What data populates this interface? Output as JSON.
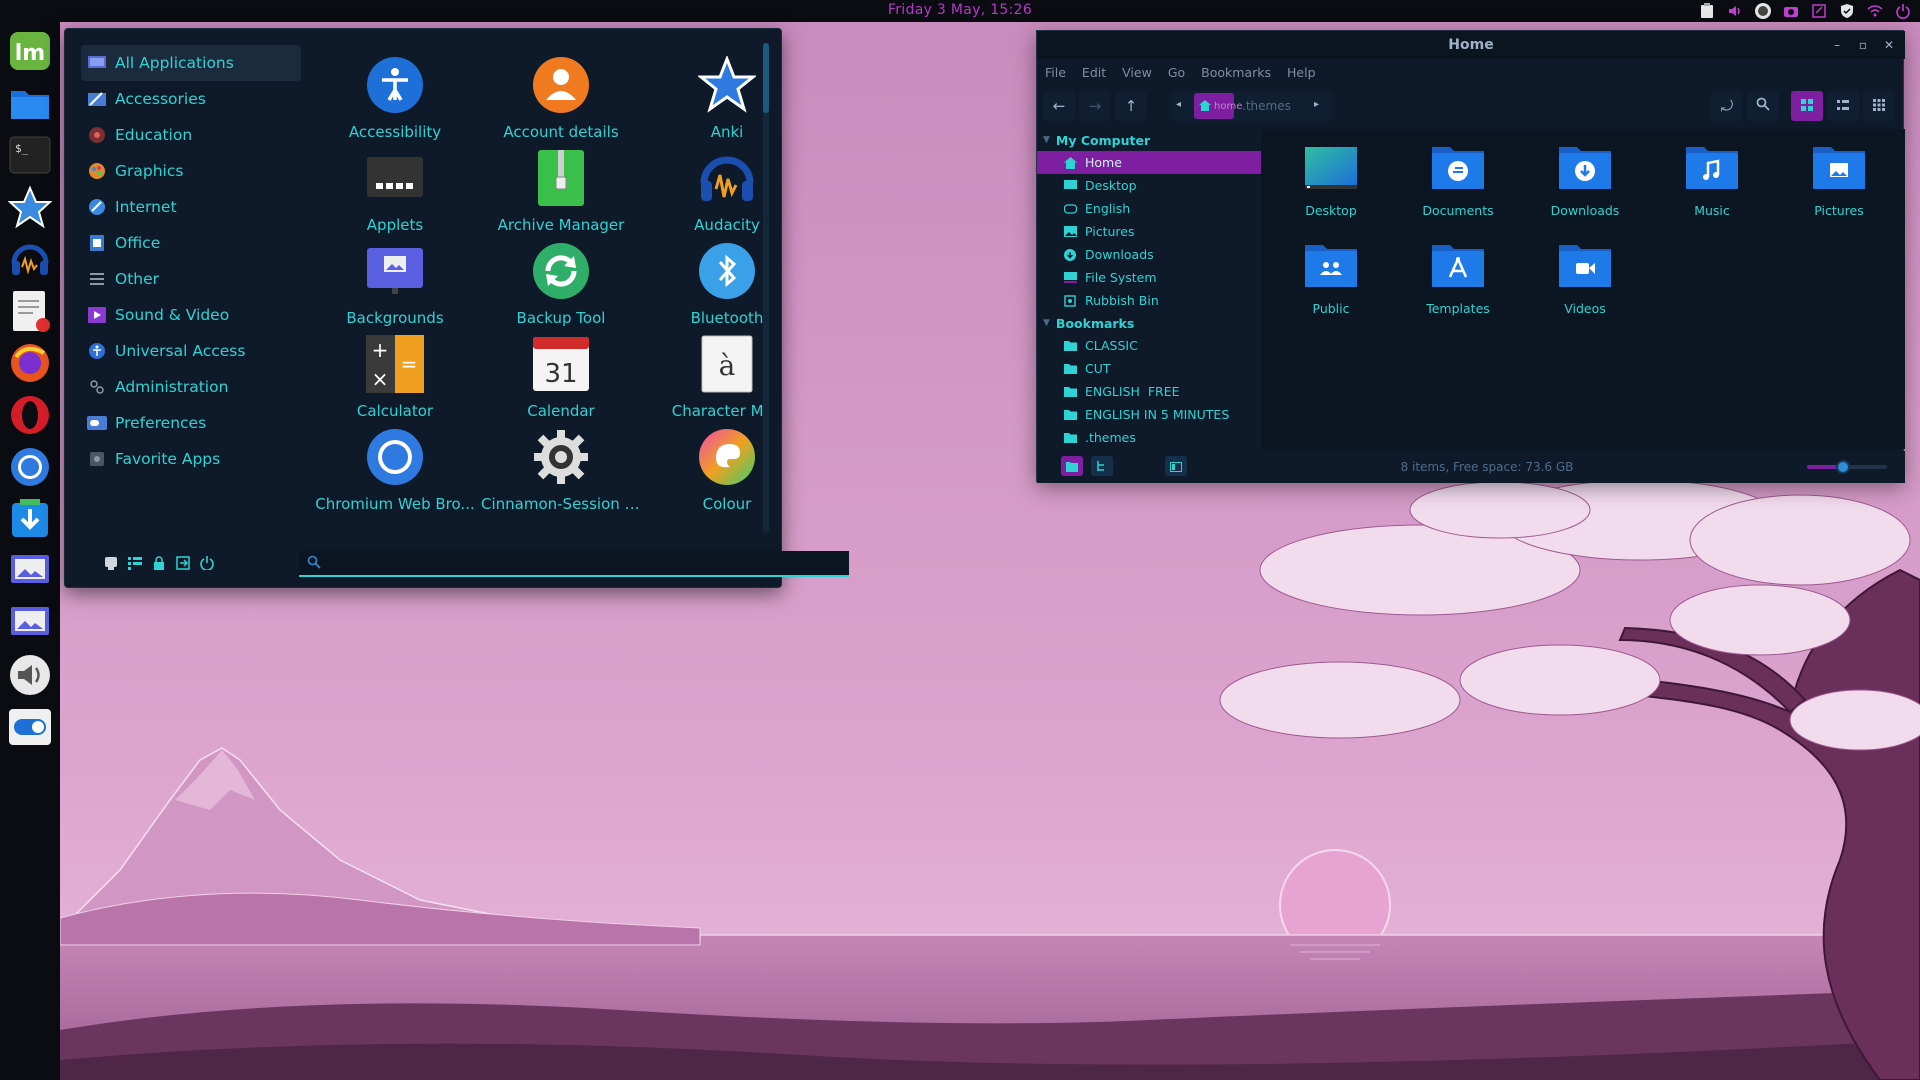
{
  "topbar": {
    "clock": "Friday  3 May, 15:26",
    "tray": [
      {
        "icon": "clipboard-icon"
      },
      {
        "icon": "volume-icon"
      },
      {
        "icon": "brightness-icon"
      },
      {
        "icon": "screenshot-icon"
      },
      {
        "icon": "notes-icon"
      },
      {
        "icon": "shield-icon"
      },
      {
        "icon": "wifi-icon"
      },
      {
        "icon": "power-icon"
      }
    ]
  },
  "dock": {
    "items": [
      {
        "name": "mint-menu",
        "icon": "linux-mint-icon"
      },
      {
        "name": "files",
        "icon": "folder-icon"
      },
      {
        "name": "terminal",
        "icon": "terminal-icon"
      },
      {
        "name": "anki",
        "icon": "star-icon"
      },
      {
        "name": "audacity",
        "icon": "headphones-icon"
      },
      {
        "name": "text-editor",
        "icon": "text-editor-icon"
      },
      {
        "name": "firefox",
        "icon": "firefox-icon"
      },
      {
        "name": "opera",
        "icon": "opera-icon"
      },
      {
        "name": "chromium",
        "icon": "chromium-icon"
      },
      {
        "name": "downloader",
        "icon": "download-icon"
      },
      {
        "name": "image-viewer",
        "icon": "image-viewer-icon"
      },
      {
        "name": "image-viewer-2",
        "icon": "image-viewer-icon"
      },
      {
        "name": "volume",
        "icon": "speaker-icon"
      },
      {
        "name": "toggle",
        "icon": "toggle-icon"
      }
    ]
  },
  "menu": {
    "categories": [
      {
        "label": "All Applications",
        "icon": "all-apps-icon",
        "color": "#5b6bd6",
        "active": true
      },
      {
        "label": "Accessories",
        "icon": "accessories-icon",
        "color": "#4a7bd6"
      },
      {
        "label": "Education",
        "icon": "education-icon",
        "color": "#c0504d"
      },
      {
        "label": "Graphics",
        "icon": "graphics-icon",
        "color": "#e08a2c"
      },
      {
        "label": "Internet",
        "icon": "internet-icon",
        "color": "#3a8ae0"
      },
      {
        "label": "Office",
        "icon": "office-icon",
        "color": "#3a7ad0"
      },
      {
        "label": "Other",
        "icon": "other-icon",
        "color": "#6e7c8c"
      },
      {
        "label": "Sound & Video",
        "icon": "sound-video-icon",
        "color": "#8a3ad0"
      },
      {
        "label": "Universal Access",
        "icon": "universal-access-icon",
        "color": "#2f6fd6"
      },
      {
        "label": "Administration",
        "icon": "administration-icon",
        "color": "#6e7c8c"
      },
      {
        "label": "Preferences",
        "icon": "preferences-icon",
        "color": "#4a7bd6"
      },
      {
        "label": "Favorite Apps",
        "icon": "favorite-apps-icon",
        "color": "#6e7c8c"
      }
    ],
    "apps": [
      {
        "label": "Accessibility",
        "icon": "accessibility-icon"
      },
      {
        "label": "Account details",
        "icon": "account-icon"
      },
      {
        "label": "Anki",
        "icon": "anki-star-icon"
      },
      {
        "label": "Applets",
        "icon": "applets-icon"
      },
      {
        "label": "Archive Manager",
        "icon": "archive-icon"
      },
      {
        "label": "Audacity",
        "icon": "audacity-icon"
      },
      {
        "label": "Backgrounds",
        "icon": "backgrounds-icon"
      },
      {
        "label": "Backup Tool",
        "icon": "backup-icon"
      },
      {
        "label": "Bluetooth",
        "icon": "bluetooth-icon"
      },
      {
        "label": "Calculator",
        "icon": "calculator-icon"
      },
      {
        "label": "Calendar",
        "icon": "calendar-icon",
        "day": "31"
      },
      {
        "label": "Character Map",
        "icon": "character-map-icon",
        "glyph": "à"
      },
      {
        "label": "Chromium Web Bro...",
        "icon": "chromium-icon"
      },
      {
        "label": "Cinnamon-Session --...",
        "icon": "gear-icon"
      },
      {
        "label": "Colour",
        "icon": "colour-icon"
      }
    ],
    "bottom_buttons": [
      {
        "icon": "computer-icon"
      },
      {
        "icon": "list-icon"
      },
      {
        "icon": "lock-icon"
      },
      {
        "icon": "logout-icon"
      },
      {
        "icon": "power-icon"
      }
    ],
    "search": {
      "value": "",
      "placeholder": ""
    }
  },
  "file_manager": {
    "title": "Home",
    "menubar": [
      "File",
      "Edit",
      "View",
      "Go",
      "Bookmarks",
      "Help"
    ],
    "breadcrumb": {
      "home": "home",
      "current": ".themes"
    },
    "sidebar": {
      "my_computer": {
        "label": "My Computer",
        "items": [
          {
            "label": "Home",
            "icon": "home-icon",
            "active": true
          },
          {
            "label": "Desktop",
            "icon": "desktop-icon"
          },
          {
            "label": "English",
            "icon": "drive-icon"
          },
          {
            "label": "Pictures",
            "icon": "pictures-icon"
          },
          {
            "label": "Downloads",
            "icon": "downloads-icon"
          },
          {
            "label": "File System",
            "icon": "filesystem-icon"
          },
          {
            "label": "Rubbish Bin",
            "icon": "trash-icon"
          }
        ]
      },
      "bookmarks": {
        "label": "Bookmarks",
        "items": [
          {
            "label": "CLASSIC",
            "icon": "folder-icon"
          },
          {
            "label": "CUT",
            "icon": "folder-icon"
          },
          {
            "label": "ENGLISH  FREE",
            "icon": "folder-icon"
          },
          {
            "label": "ENGLISH IN 5 MINUTES",
            "icon": "folder-icon"
          },
          {
            "label": ".themes",
            "icon": "folder-icon"
          }
        ]
      }
    },
    "items": [
      {
        "label": "Desktop",
        "icon": "desktop-folder-icon"
      },
      {
        "label": "Documents",
        "icon": "documents-folder-icon"
      },
      {
        "label": "Downloads",
        "icon": "downloads-folder-icon"
      },
      {
        "label": "Music",
        "icon": "music-folder-icon"
      },
      {
        "label": "Pictures",
        "icon": "pictures-folder-icon"
      },
      {
        "label": "Public",
        "icon": "public-folder-icon"
      },
      {
        "label": "Templates",
        "icon": "templates-folder-icon"
      },
      {
        "label": "Videos",
        "icon": "videos-folder-icon"
      }
    ],
    "status": "8 items, Free space: 73.6 GB",
    "zoom_level": 0.45
  },
  "colors": {
    "accent": "#2fd3d3",
    "purple": "#7e1ea0",
    "panel": "#0e1a2a",
    "wallpaper": "#d9a0cc"
  }
}
